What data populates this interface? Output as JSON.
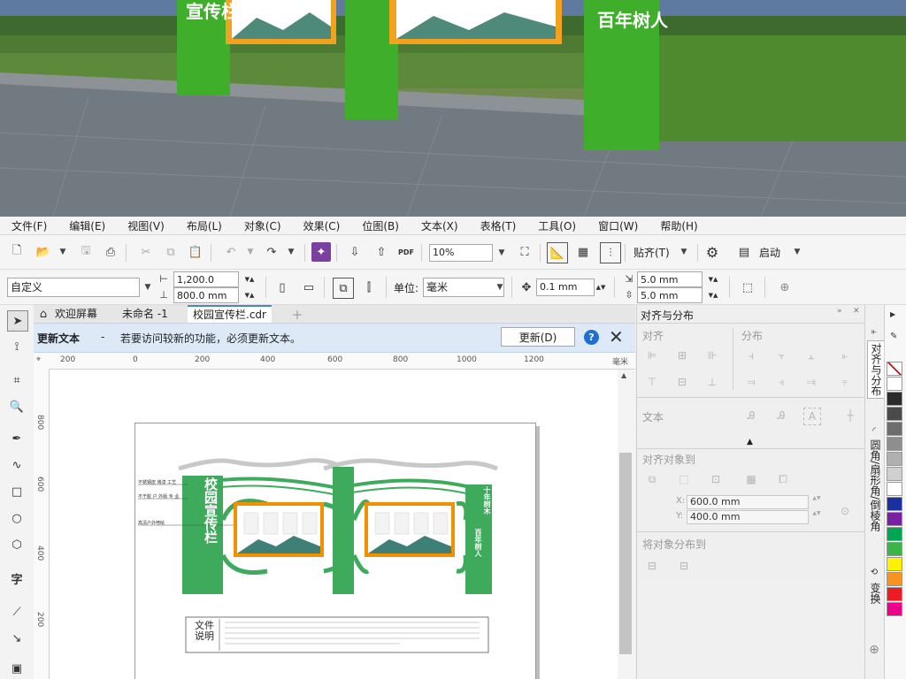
{
  "menu": [
    "文件(F)",
    "编辑(E)",
    "视图(V)",
    "布局(L)",
    "对象(C)",
    "效果(C)",
    "位图(B)",
    "文本(X)",
    "表格(T)",
    "工具(O)",
    "窗口(W)",
    "帮助(H)"
  ],
  "toolbar": {
    "zoom_value": "10%",
    "snap_label": "贴齐(T)",
    "launch_label": "启动",
    "pdf_label": "PDF"
  },
  "property_bar": {
    "page_size": "自定义",
    "width": "1,200.0 mm",
    "height": "800.0 mm",
    "unit_label": "单位:",
    "unit_value": "毫米",
    "nudge": "0.1 mm",
    "dup_x": "5.0 mm",
    "dup_y": "5.0 mm"
  },
  "tabs": [
    "欢迎屏幕",
    "未命名 -1",
    "校园宣传栏.cdr"
  ],
  "notification": {
    "title": "更新文本",
    "dash": "-",
    "message": "若要访问较新的功能，必须更新文本。",
    "button": "更新(D)"
  },
  "ruler": {
    "h_ticks": [
      "200",
      "0",
      "200",
      "400",
      "600",
      "800",
      "1000",
      "1200"
    ],
    "h_unit": "毫米",
    "v_ticks": [
      "800",
      "600",
      "400",
      "200"
    ]
  },
  "artwork": {
    "left_column_text": "校园宣传栏",
    "right_column_text_1": "十年树木",
    "right_column_text_2": "百年树人",
    "notes": [
      "不锈钢皮 烤漆 工艺",
      "不干胶 户 外版 专 业",
      "高清户外喷绘"
    ],
    "file_label": "文件说明"
  },
  "photo_text": [
    "宣传栏",
    "百年树人"
  ],
  "panel": {
    "title": "对齐与分布",
    "align_heading": "对齐",
    "distribute_heading": "分布",
    "text_heading": "文本",
    "align_to_heading": "对齐对象到",
    "x_label": "X:",
    "x_value": "600.0 mm",
    "y_label": "Y:",
    "y_value": "400.0 mm",
    "distribute_to_heading": "将对象分布到"
  },
  "side_tabs": [
    "对齐与分布",
    "圆角/扇形角/倒棱角",
    "变换"
  ],
  "palette_colors": [
    "#ffffff",
    "#2b2b2b",
    "#4a4a4a",
    "#6d6d6d",
    "#8e8e8e",
    "#b0b0b0",
    "#d0d0d0",
    "#ffffff",
    "#1a2fa0",
    "#7b1fa2",
    "#00a651",
    "#39b54a",
    "#fff200",
    "#f7941d",
    "#ed1c24",
    "#ec008c"
  ]
}
